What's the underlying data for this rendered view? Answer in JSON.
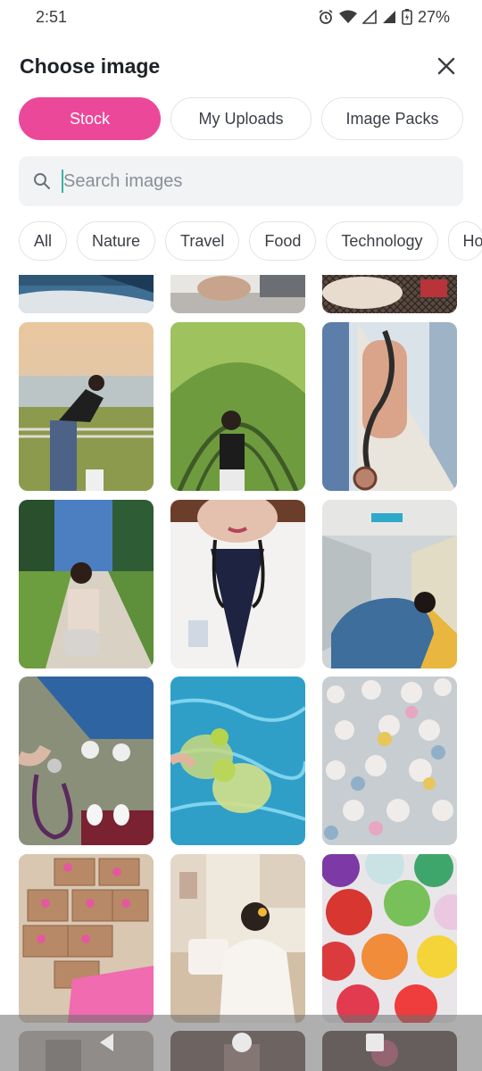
{
  "status": {
    "time": "2:51",
    "battery": "27%"
  },
  "header": {
    "title": "Choose image"
  },
  "source_tabs": [
    {
      "label": "Stock",
      "active": true
    },
    {
      "label": "My Uploads",
      "active": false
    },
    {
      "label": "Image Packs",
      "active": false
    }
  ],
  "search": {
    "placeholder": "Search images",
    "value": ""
  },
  "categories": [
    "All",
    "Nature",
    "Travel",
    "Food",
    "Technology",
    "Ho"
  ],
  "accent_color": "#ec4899",
  "images": [
    {
      "name": "image-yacht-deck"
    },
    {
      "name": "image-boat-seat"
    },
    {
      "name": "image-net-lounge"
    },
    {
      "name": "image-sunset-railing"
    },
    {
      "name": "image-vine-arch"
    },
    {
      "name": "image-hand-stethoscope"
    },
    {
      "name": "image-garden-path"
    },
    {
      "name": "image-doctor-selfie"
    },
    {
      "name": "image-hospital-corridor"
    },
    {
      "name": "image-stethoscope-floor"
    },
    {
      "name": "image-pool-drinks"
    },
    {
      "name": "image-plush-toys"
    },
    {
      "name": "image-sticker-boxes"
    },
    {
      "name": "image-sewing-desk"
    },
    {
      "name": "image-candy-cups"
    },
    {
      "name": "image-bottom-left"
    },
    {
      "name": "image-bottom-middle"
    },
    {
      "name": "image-bottom-right"
    }
  ]
}
